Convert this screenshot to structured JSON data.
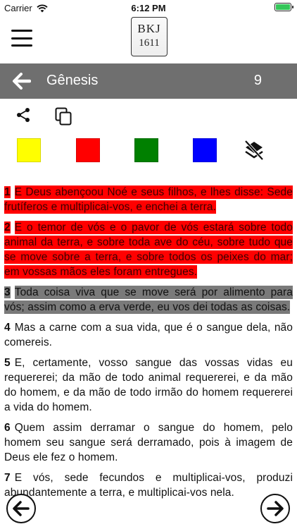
{
  "status_bar": {
    "carrier": "Carrier",
    "time": "6:12 PM"
  },
  "app": {
    "logo_line1": "BKJ",
    "logo_line2": "1611"
  },
  "title_bar": {
    "book": "Gênesis",
    "chapter": "9"
  },
  "highlight_colors": {
    "yellow": "#ffff00",
    "red": "#ff0000",
    "green": "#008000",
    "blue": "#0000ff"
  },
  "verses": [
    {
      "num": "1",
      "text": "E Deus abençoou Noé e seus filhos, e lhes disse: Sede frutíferos e multiplicai-vos, e enchei a terra.",
      "highlight": "red"
    },
    {
      "num": "2",
      "text": "E o temor de vós e o pavor de vós estará sobre todo animal da terra, e sobre toda ave do céu, sobre tudo que se move sobre a terra, e sobre todos os peixes do mar; em vossas mãos eles foram entregues.",
      "highlight": "red"
    },
    {
      "num": "3",
      "text": "Toda coisa viva que se move será por alimento para vós; assim como a erva verde, eu vos dei todas as coisas.",
      "highlight": "gray"
    },
    {
      "num": "4",
      "text": "Mas a carne com a sua vida, que é o sangue dela, não comereis.",
      "highlight": "none"
    },
    {
      "num": "5",
      "text": "E, certamente, vosso sangue das vossas vidas eu requererei; da mão de todo animal requererei, e da mão do homem, e da mão de todo irmão do homem requererei a vida do homem.",
      "highlight": "none"
    },
    {
      "num": "6",
      "text": "Quem assim derramar o sangue do homem, pelo homem seu sangue será derramado, pois à imagem de Deus ele fez o homem.",
      "highlight": "none"
    },
    {
      "num": "7",
      "text": "E vós, sede fecundos e multiplicai-vos, produzi abundantemente a terra, e multiplicai-vos nela.",
      "highlight": "none"
    }
  ]
}
